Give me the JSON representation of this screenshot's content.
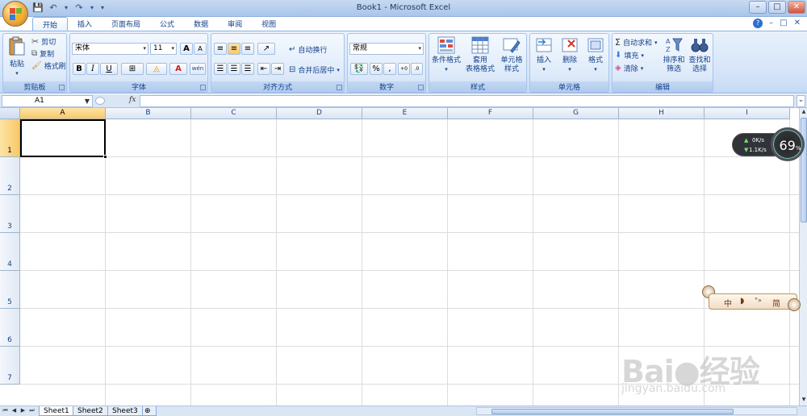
{
  "window": {
    "title": "Book1 - Microsoft Excel",
    "min_glyph": "–",
    "max_glyph": "□",
    "close_glyph": "✕"
  },
  "quick_access": {
    "save": "💾",
    "undo": "↶",
    "redo": "↷",
    "more": "▾"
  },
  "tabs": [
    "开始",
    "插入",
    "页面布局",
    "公式",
    "数据",
    "审阅",
    "视图"
  ],
  "tabs_right": {
    "help": "?",
    "min": "–",
    "restore": "□",
    "close": "✕"
  },
  "ribbon": {
    "clipboard": {
      "label": "剪贴板",
      "paste": "粘贴",
      "cut": "剪切",
      "copy": "复制",
      "format_painter": "格式刷"
    },
    "font": {
      "label": "字体",
      "font_name": "宋体",
      "font_size": "11",
      "grow": "A",
      "shrink": "A",
      "bold": "B",
      "italic": "I",
      "underline": "U",
      "font_color_letter": "A",
      "phonetic": "wén"
    },
    "alignment": {
      "label": "对齐方式",
      "wrap": "自动换行",
      "merge": "合并后居中"
    },
    "number": {
      "label": "数字",
      "format": "常规",
      "percent": "%",
      "comma": ",",
      "inc_dec": "+.0 .00",
      "dec_dec": ".00 +.0"
    },
    "styles": {
      "label": "样式",
      "conditional": "条件格式",
      "table_line1": "套用",
      "table_line2": "表格格式",
      "cell_line1": "单元格",
      "cell_line2": "样式"
    },
    "cells": {
      "label": "单元格",
      "insert": "插入",
      "delete": "删除",
      "format": "格式"
    },
    "editing": {
      "label": "编辑",
      "autosum": "自动求和",
      "fill": "填充",
      "clear": "清除",
      "sort_line1": "排序和",
      "sort_line2": "筛选",
      "find_line1": "查找和",
      "find_line2": "选择"
    }
  },
  "formula_bar": {
    "name_box": "A1",
    "fx": "fx",
    "value": ""
  },
  "columns": [
    "A",
    "B",
    "C",
    "D",
    "E",
    "F",
    "G",
    "H",
    "I"
  ],
  "rows": [
    "1",
    "2",
    "3",
    "4",
    "5",
    "6",
    "7"
  ],
  "active_cell": "A1",
  "sheets": [
    "Sheet1",
    "Sheet2",
    "Sheet3"
  ],
  "net_widget": {
    "up": "0K/s",
    "down": "1.1K/s",
    "percent": "69",
    "percent_unit": "%"
  },
  "ime_bar": {
    "lang": "中",
    "moon": "◗",
    "punct": "°»",
    "simp": "简"
  },
  "watermark": {
    "main": "Bai●经验",
    "sub": "jingyan.baidu.com"
  },
  "colors": {
    "accent": "#15428b",
    "ribbon_bg": "#d4e4f8",
    "selected_header": "#f9c86a"
  }
}
